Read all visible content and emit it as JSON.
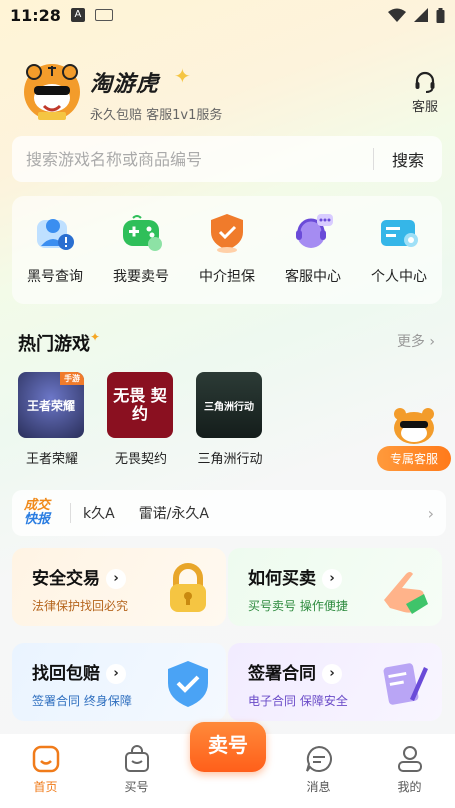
{
  "status_bar": {
    "time": "11:28",
    "icon_a": "A"
  },
  "header": {
    "brand": "淘游虎",
    "slogan": "永久包赔 客服1v1服务",
    "service_label": "客服",
    "logo_icon": "tiger-mascot-icon"
  },
  "search": {
    "placeholder": "搜索游戏名称或商品编号",
    "button": "搜索"
  },
  "quick_menu": [
    {
      "label": "黑号查询",
      "icon": "user-alert-icon"
    },
    {
      "label": "我要卖号",
      "icon": "gamepad-icon"
    },
    {
      "label": "中介担保",
      "icon": "shield-check-icon"
    },
    {
      "label": "客服中心",
      "icon": "headset-icon"
    },
    {
      "label": "个人中心",
      "icon": "id-card-icon"
    }
  ],
  "hot_games": {
    "title": "热门游戏",
    "more": "更多",
    "items": [
      {
        "name": "王者荣耀",
        "image_text": "王者荣耀",
        "tag": "手游"
      },
      {
        "name": "无畏契约",
        "image_text": "无畏 契约"
      },
      {
        "name": "三角洲行动",
        "image_text": "三角洲行动"
      }
    ]
  },
  "float_service": {
    "label": "专属客服"
  },
  "ticker": {
    "tag_top": "成交",
    "tag_bottom": "快报",
    "items": [
      "k久A",
      "雷诺/永久A"
    ]
  },
  "cards": [
    {
      "title": "安全交易",
      "subtitle": "法律保护找回必究",
      "icon": "lock-icon"
    },
    {
      "title": "如何买卖",
      "subtitle": "买号卖号 操作便捷",
      "icon": "pointing-hand-icon"
    },
    {
      "title": "找回包赔",
      "subtitle": "签署合同 终身保障",
      "icon": "shield-icon"
    },
    {
      "title": "签署合同",
      "subtitle": "电子合同 保障安全",
      "icon": "contract-icon"
    }
  ],
  "tab_bar": {
    "items": [
      {
        "label": "首页",
        "icon": "home-icon",
        "active": true
      },
      {
        "label": "买号",
        "icon": "shopping-bag-icon",
        "active": false
      },
      {
        "label": "消息",
        "icon": "message-icon",
        "active": false
      },
      {
        "label": "我的",
        "icon": "user-icon",
        "active": false
      }
    ],
    "sell_label": "卖号"
  },
  "colors": {
    "accent": "#f07b1a",
    "blue": "#2a7de1"
  }
}
